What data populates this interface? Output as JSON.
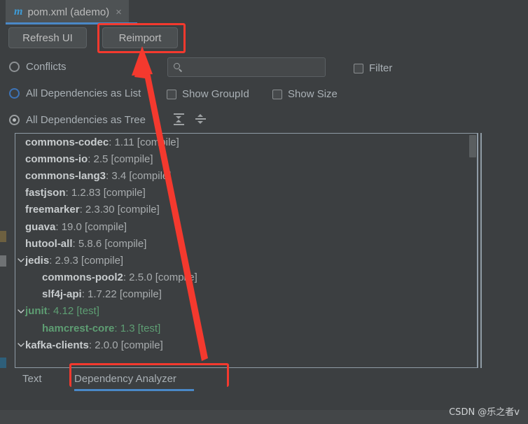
{
  "window": {
    "background_color": "#3c3f41",
    "accent_color": "#4a88c7",
    "annotation_color": "#f4392e"
  },
  "editor_tab": {
    "icon": "maven-m-icon",
    "icon_letter": "m",
    "title": "pom.xml (ademo)",
    "close_glyph": "×"
  },
  "toolbar": {
    "refresh_label": "Refresh UI",
    "reimport_label": "Reimport"
  },
  "view_options": [
    {
      "label": "Conflicts",
      "selected": false,
      "focused": false
    },
    {
      "label": "All Dependencies as List",
      "selected": false,
      "focused": true
    },
    {
      "label": "All Dependencies as Tree",
      "selected": true,
      "focused": false
    }
  ],
  "checkboxes": [
    {
      "label": "Filter",
      "checked": false
    },
    {
      "label": "Show GroupId",
      "checked": false
    },
    {
      "label": "Show Size",
      "checked": false
    }
  ],
  "search": {
    "value": "",
    "placeholder": "",
    "icon": "search-icon"
  },
  "tree_toolbar": [
    {
      "name": "expand-all-icon",
      "tooltip": "Expand All"
    },
    {
      "name": "collapse-all-icon",
      "tooltip": "Collapse All"
    }
  ],
  "dependency_tree": {
    "rows": [
      {
        "indent": 1,
        "twisty": "none",
        "name": "commons-codec",
        "version": "1.11",
        "scope": "compile"
      },
      {
        "indent": 1,
        "twisty": "none",
        "name": "commons-io",
        "version": "2.5",
        "scope": "compile"
      },
      {
        "indent": 1,
        "twisty": "none",
        "name": "commons-lang3",
        "version": "3.4",
        "scope": "compile"
      },
      {
        "indent": 1,
        "twisty": "none",
        "name": "fastjson",
        "version": "1.2.83",
        "scope": "compile"
      },
      {
        "indent": 1,
        "twisty": "none",
        "name": "freemarker",
        "version": "2.3.30",
        "scope": "compile"
      },
      {
        "indent": 1,
        "twisty": "none",
        "name": "guava",
        "version": "19.0",
        "scope": "compile"
      },
      {
        "indent": 1,
        "twisty": "none",
        "name": "hutool-all",
        "version": "5.8.6",
        "scope": "compile"
      },
      {
        "indent": 1,
        "twisty": "expanded",
        "name": "jedis",
        "version": "2.9.3",
        "scope": "compile"
      },
      {
        "indent": 2,
        "twisty": "none",
        "name": "commons-pool2",
        "version": "2.5.0",
        "scope": "compile"
      },
      {
        "indent": 2,
        "twisty": "none",
        "name": "slf4j-api",
        "version": "1.7.22",
        "scope": "compile"
      },
      {
        "indent": 1,
        "twisty": "expanded",
        "name": "junit",
        "version": "4.12",
        "scope": "test"
      },
      {
        "indent": 2,
        "twisty": "none",
        "name": "hamcrest-core",
        "version": "1.3",
        "scope": "test"
      },
      {
        "indent": 1,
        "twisty": "expanded",
        "name": "kafka-clients",
        "version": "2.0.0",
        "scope": "compile"
      }
    ],
    "separator": " : ",
    "scope_open": "[",
    "scope_close": "]"
  },
  "scrollbar": {
    "name": "vertical-scrollbar",
    "thumb_position_pct": 0
  },
  "bottom_tabs": [
    {
      "label": "Text",
      "active": false
    },
    {
      "label": "Dependency Analyzer",
      "active": true
    }
  ],
  "annotations": [
    {
      "name": "reimport-highlight",
      "target": "Reimport"
    },
    {
      "name": "dependency-analyzer-highlight",
      "target": "Dependency Analyzer"
    },
    {
      "name": "pointer-arrow",
      "from": "Dependency Analyzer",
      "to": "Reimport"
    }
  ],
  "watermark": "CSDN @乐之者v"
}
